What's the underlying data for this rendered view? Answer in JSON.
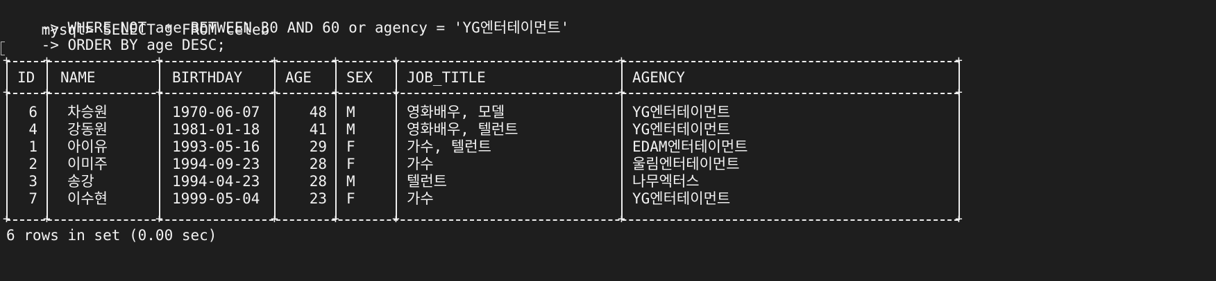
{
  "terminal": {
    "prompt": "mysql>",
    "query": [
      " SELECT * FROM celeb",
      "    -> WHERE NOT age BETWEEN 30 AND 60 or agency = 'YG엔터테이먼트'",
      "    -> ORDER BY age DESC;"
    ],
    "columns": [
      "ID",
      "NAME",
      "BIRTHDAY",
      "AGE",
      "SEX",
      "JOB_TITLE",
      "AGENCY"
    ],
    "rows": [
      {
        "id": "6",
        "name": "차승원",
        "birthday": "1970-06-07",
        "age": "48",
        "sex": "M",
        "job_title": "영화배우, 모델",
        "agency": "YG엔터테이먼트"
      },
      {
        "id": "4",
        "name": "강동원",
        "birthday": "1981-01-18",
        "age": "41",
        "sex": "M",
        "job_title": "영화배우, 텔런트",
        "agency": "YG엔터테이먼트"
      },
      {
        "id": "1",
        "name": "아이유",
        "birthday": "1993-05-16",
        "age": "29",
        "sex": "F",
        "job_title": "가수, 텔런트",
        "agency": "EDAM엔터테이먼트"
      },
      {
        "id": "2",
        "name": "이미주",
        "birthday": "1994-09-23",
        "age": "28",
        "sex": "F",
        "job_title": "가수",
        "agency": "울림엔터테이먼트"
      },
      {
        "id": "3",
        "name": "송강",
        "birthday": "1994-04-23",
        "age": "28",
        "sex": "M",
        "job_title": "텔런트",
        "agency": "나무엑터스"
      },
      {
        "id": "7",
        "name": "이수현",
        "birthday": "1999-05-04",
        "age": "23",
        "sex": "F",
        "job_title": "가수",
        "agency": "YG엔터테이먼트"
      }
    ],
    "footer": "6 rows in set (0.00 sec)"
  }
}
